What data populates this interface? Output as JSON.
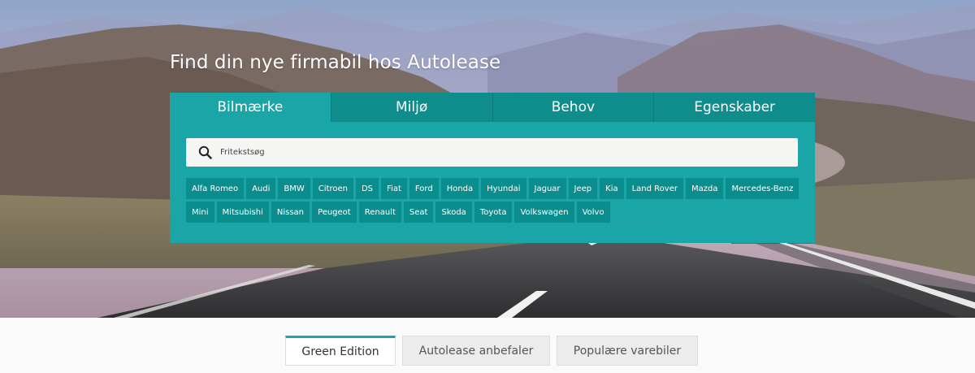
{
  "hero": {
    "title": "Find din nye firmabil hos Autolease"
  },
  "panel": {
    "tabs": [
      {
        "label": "Bilmærke",
        "active": true
      },
      {
        "label": "Miljø",
        "active": false
      },
      {
        "label": "Behov",
        "active": false
      },
      {
        "label": "Egenskaber",
        "active": false
      }
    ],
    "search": {
      "placeholder": "Fritekstsøg",
      "icon": "search-icon"
    },
    "brands_row1": [
      "Alfa Romeo",
      "Audi",
      "BMW",
      "Citroen",
      "DS",
      "Fiat",
      "Ford",
      "Honda",
      "Hyundai",
      "Jaguar",
      "Jeep",
      "Kia",
      "Land Rover",
      "Mazda",
      "Mercedes-Benz"
    ],
    "brands_row2": [
      "Mini",
      "Mitsubishi",
      "Nissan",
      "Peugeot",
      "Renault",
      "Seat",
      "Skoda",
      "Toyota",
      "Volkswagen",
      "Volvo"
    ]
  },
  "bottom_tabs": [
    {
      "label": "Green Edition",
      "active": true
    },
    {
      "label": "Autolease anbefaler",
      "active": false
    },
    {
      "label": "Populære varebiler",
      "active": false
    }
  ],
  "colors": {
    "accent": "#1aa6a6",
    "tab_inactive": "#0f8c8c",
    "brand_button": "#0c8d8d"
  }
}
